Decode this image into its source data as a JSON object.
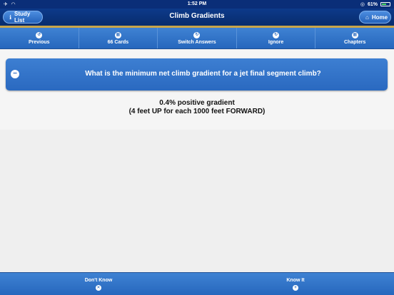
{
  "status": {
    "time": "1:52 PM",
    "battery": "61%",
    "battery_level": 0.61
  },
  "nav": {
    "title": "Climb Gradients",
    "left_button": "Study List",
    "right_button": "Home"
  },
  "toolbar": {
    "items": [
      {
        "label": "Previous",
        "icon": "undo-icon"
      },
      {
        "label": "66 Cards",
        "icon": "grid-icon"
      },
      {
        "label": "Switch Answers",
        "icon": "switch-icon"
      },
      {
        "label": "Ignore",
        "icon": "ignore-icon"
      },
      {
        "label": "Chapters",
        "icon": "chapters-icon"
      }
    ]
  },
  "card": {
    "question": "What is the minimum net climb gradient for a jet final segment climb?",
    "answer_line1": "0.4% positive gradient",
    "answer_line2": "(4 feet UP for each 1000 feet FORWARD)"
  },
  "bottom": {
    "left_label": "Don't Know",
    "right_label": "Know It"
  },
  "colors": {
    "nav": "#0a2e78",
    "accent": "#2a69c0",
    "stripe": "#c9a54a",
    "battery": "#4cd964"
  }
}
